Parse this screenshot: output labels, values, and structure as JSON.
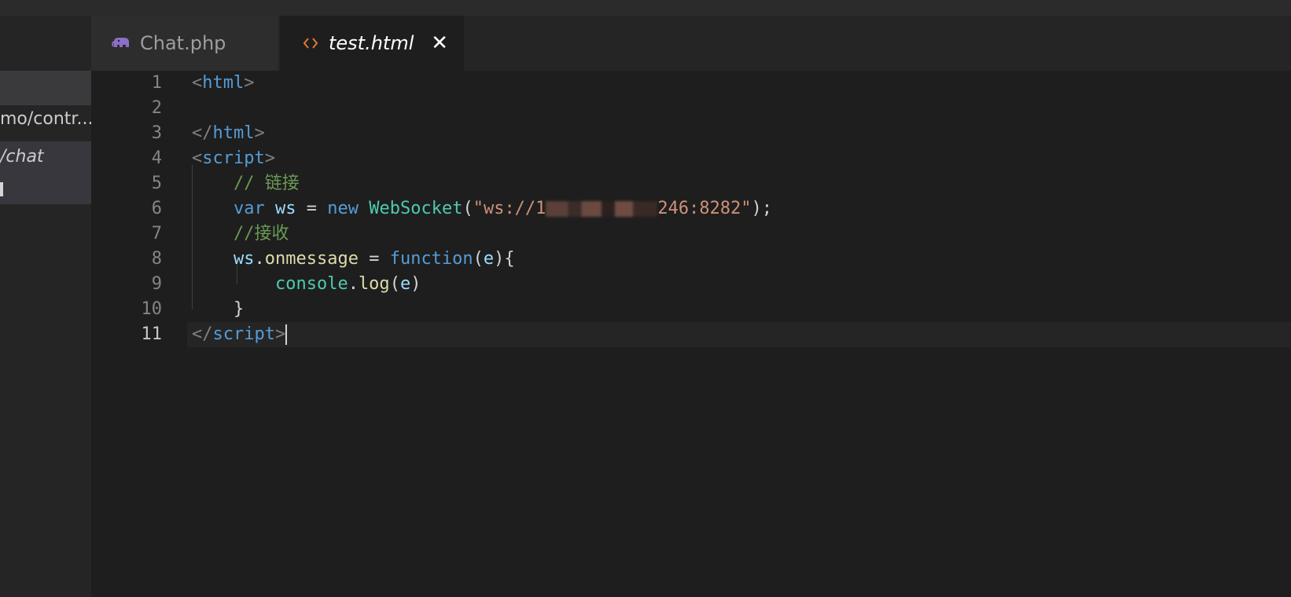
{
  "sidebar": {
    "items": [
      "mo/contr...",
      "/chat"
    ]
  },
  "tabs": [
    {
      "label": "Chat.php",
      "icon": "php-elephant-icon"
    },
    {
      "label": "test.html",
      "icon": "html-code-icon",
      "active": true
    }
  ],
  "editor": {
    "line_numbers": [
      "1",
      "2",
      "3",
      "4",
      "5",
      "6",
      "7",
      "8",
      "9",
      "10",
      "11"
    ],
    "current_line": 11
  },
  "tokens": {
    "lt": "<",
    "lt_slash": "</",
    "gt": ">",
    "html": "html",
    "script": "script",
    "indent1": "    ",
    "indent2": "        ",
    "space": " ",
    "comment1": "// 链接",
    "comment2": "//接收",
    "var": "var",
    "ws": "ws",
    "eq": " = ",
    "new": "new",
    "websocket": "WebSocket",
    "lparen": "(",
    "str_start": "\"ws://1",
    "str_end": "246:8282\"",
    "rparen_semi": ");",
    "dot": ".",
    "onmessage": "onmessage",
    "function": "function",
    "e": "e",
    "rparen_brace": "){",
    "console": "console",
    "log": "log",
    "rparen": ")",
    "rbrace": "}"
  },
  "colors": {
    "background": "#1e1e1e",
    "tag": "#569cd6",
    "comment": "#6a9955",
    "string": "#ce9178",
    "class": "#4ec9b0",
    "function": "#dcdcaa",
    "variable": "#9cdcfe",
    "php_icon": "#8c6fc8",
    "html_icon": "#e37933"
  }
}
